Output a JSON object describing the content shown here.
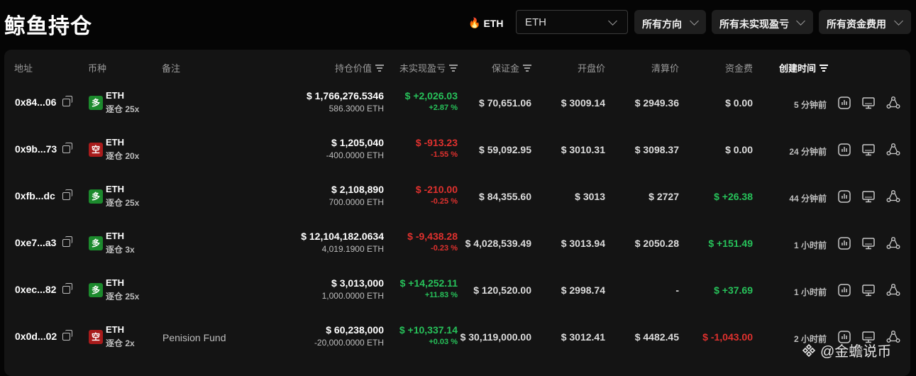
{
  "header": {
    "title": "鲸鱼持仓",
    "coin_tag": "ETH",
    "coin_select_value": "ETH",
    "filters": [
      "所有方向",
      "所有未实现盈亏",
      "所有资金费用"
    ]
  },
  "columns": [
    "地址",
    "币种",
    "备注",
    "持仓价值",
    "未实现盈亏",
    "保证金",
    "开盘价",
    "清算价",
    "资金费",
    "创建时间"
  ],
  "rows": [
    {
      "address": "0x84...06",
      "side": "多",
      "side_type": "long",
      "coin": "ETH",
      "margin_mode": "逐仓 25x",
      "note": "",
      "position_value": "$ 1,766,276.5346",
      "position_size": "586.3000 ETH",
      "pnl": "$ +2,026.03",
      "pnl_pct": "+2.87 %",
      "pnl_color": "green",
      "margin": "$ 70,651.06",
      "entry": "$ 3009.14",
      "liq": "$ 2949.36",
      "funding": "$ 0.00",
      "funding_color": "neutral",
      "created": "5 分钟前"
    },
    {
      "address": "0x9b...73",
      "side": "空",
      "side_type": "short",
      "coin": "ETH",
      "margin_mode": "逐仓 20x",
      "note": "",
      "position_value": "$ 1,205,040",
      "position_size": "-400.0000 ETH",
      "pnl": "$ -913.23",
      "pnl_pct": "-1.55 %",
      "pnl_color": "red",
      "margin": "$ 59,092.95",
      "entry": "$ 3010.31",
      "liq": "$ 3098.37",
      "funding": "$ 0.00",
      "funding_color": "neutral",
      "created": "24 分钟前"
    },
    {
      "address": "0xfb...dc",
      "side": "多",
      "side_type": "long",
      "coin": "ETH",
      "margin_mode": "逐仓 25x",
      "note": "",
      "position_value": "$ 2,108,890",
      "position_size": "700.0000 ETH",
      "pnl": "$ -210.00",
      "pnl_pct": "-0.25 %",
      "pnl_color": "red",
      "margin": "$ 84,355.60",
      "entry": "$ 3013",
      "liq": "$ 2727",
      "funding": "$ +26.38",
      "funding_color": "green",
      "created": "44 分钟前"
    },
    {
      "address": "0xe7...a3",
      "side": "多",
      "side_type": "long",
      "coin": "ETH",
      "margin_mode": "逐仓 3x",
      "note": "",
      "position_value": "$ 12,104,182.0634",
      "position_size": "4,019.1900 ETH",
      "pnl": "$ -9,438.28",
      "pnl_pct": "-0.23 %",
      "pnl_color": "red",
      "margin": "$ 4,028,539.49",
      "entry": "$ 3013.94",
      "liq": "$ 2050.28",
      "funding": "$ +151.49",
      "funding_color": "green",
      "created": "1 小时前"
    },
    {
      "address": "0xec...82",
      "side": "多",
      "side_type": "long",
      "coin": "ETH",
      "margin_mode": "逐仓 25x",
      "note": "",
      "position_value": "$ 3,013,000",
      "position_size": "1,000.0000 ETH",
      "pnl": "$ +14,252.11",
      "pnl_pct": "+11.83 %",
      "pnl_color": "green",
      "margin": "$ 120,520.00",
      "entry": "$ 2998.74",
      "liq": "-",
      "funding": "$ +37.69",
      "funding_color": "green",
      "created": "1 小时前"
    },
    {
      "address": "0x0d...02",
      "side": "空",
      "side_type": "short",
      "coin": "ETH",
      "margin_mode": "逐仓 2x",
      "note": "Penision Fund",
      "position_value": "$ 60,238,000",
      "position_size": "-20,000.0000 ETH",
      "pnl": "$ +10,337.14",
      "pnl_pct": "+0.03 %",
      "pnl_color": "green",
      "margin": "$ 30,119,000.00",
      "entry": "$ 3012.41",
      "liq": "$ 4482.45",
      "funding": "$ -1,043.00",
      "funding_color": "red",
      "created": "2 小时前"
    }
  ],
  "watermark": "@金蟾说币",
  "icons": {
    "flame": "flame-icon",
    "chevron": "chevron-down-icon",
    "sort": "sort-icon",
    "copy": "copy-icon",
    "chart": "chart-icon",
    "monitor": "monitor-icon",
    "share": "share-icon"
  }
}
